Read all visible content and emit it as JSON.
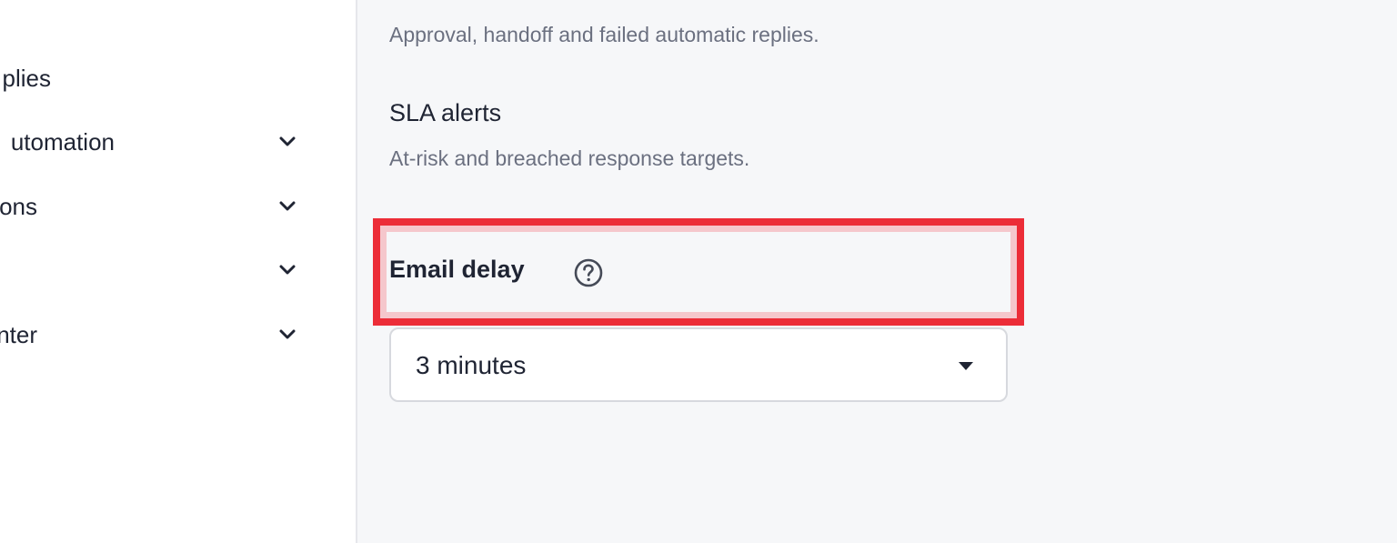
{
  "sidebar": {
    "items": [
      {
        "label": "plies",
        "has_chevron": false
      },
      {
        "label": "utomation",
        "has_chevron": true
      },
      {
        "label": "ons",
        "has_chevron": true
      },
      {
        "label": "",
        "has_chevron": true
      },
      {
        "label": "nter",
        "has_chevron": true
      }
    ]
  },
  "main": {
    "sections": [
      {
        "title": "",
        "description": "Approval, handoff and failed automatic replies."
      },
      {
        "title": "SLA alerts",
        "description": "At-risk and breached response targets."
      }
    ],
    "email_delay": {
      "label": "Email delay",
      "help_icon": "question-circle-icon",
      "selected": "3 minutes"
    }
  },
  "colors": {
    "highlight": "#ec2d38",
    "highlight_inner": "#f5c7cc",
    "text_primary": "#1f2433",
    "text_secondary": "#6b7080",
    "panel_background": "#f6f7f9"
  }
}
